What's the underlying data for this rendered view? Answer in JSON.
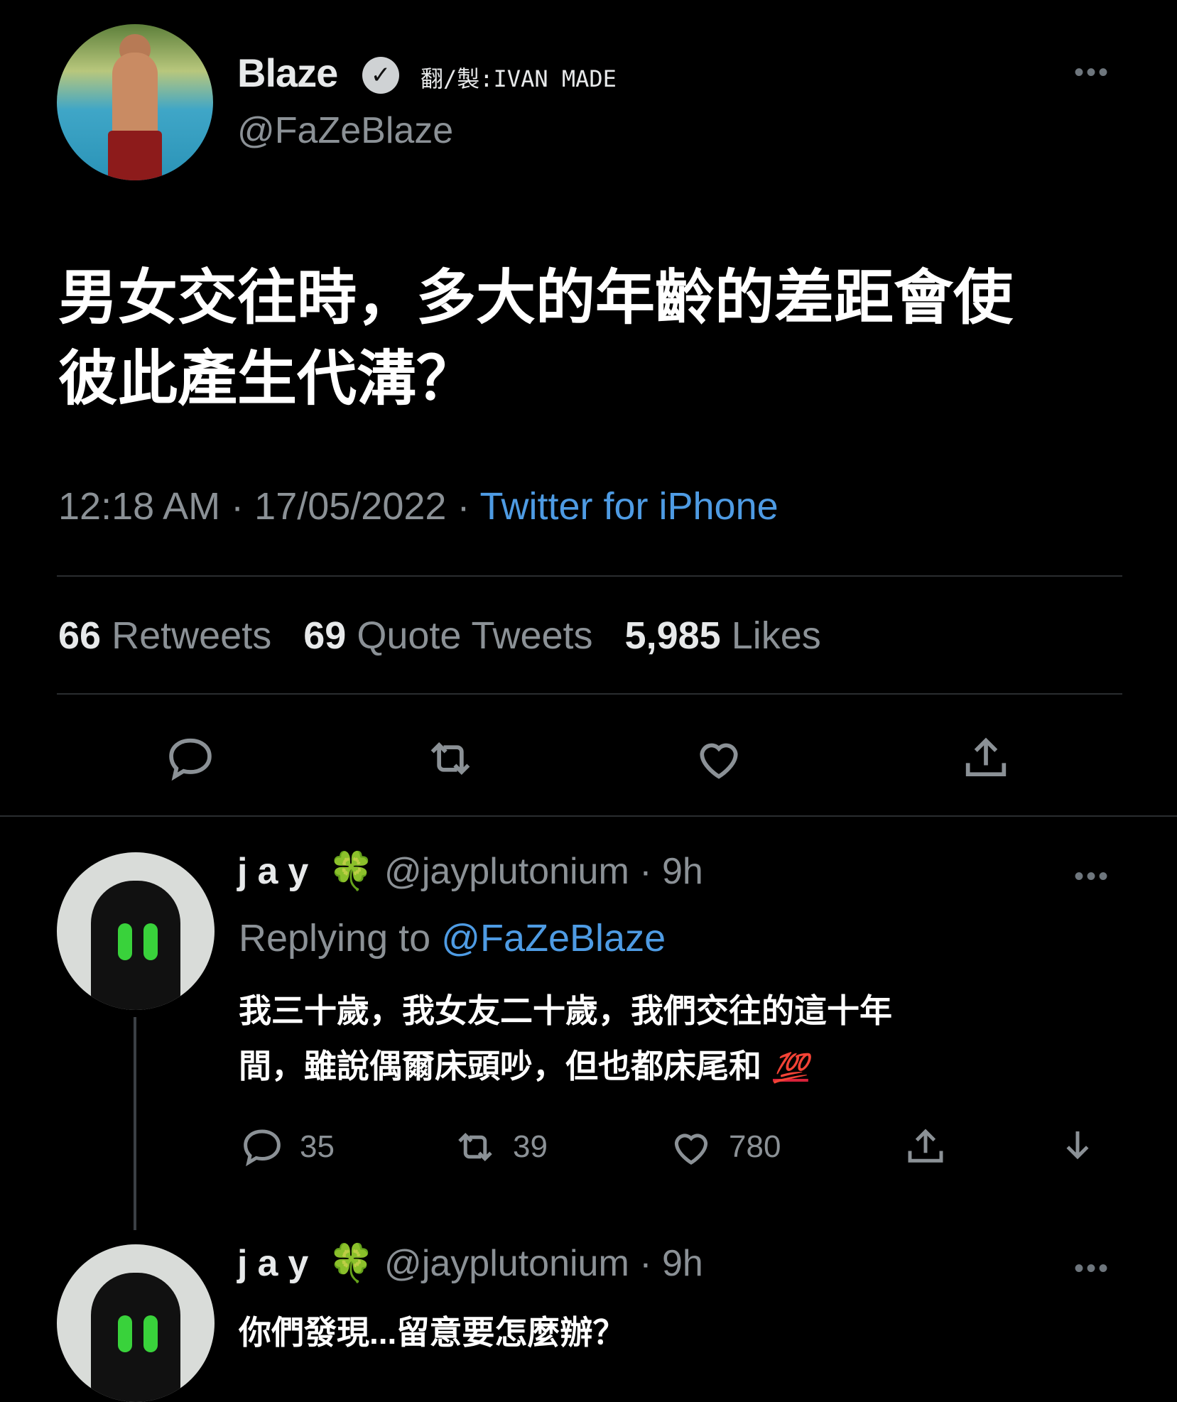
{
  "tweet": {
    "name": "Blaze",
    "verified_icon": "check-badge-icon",
    "credit": "翻/製:IVAN MADE",
    "handle": "@FaZeBlaze",
    "more": "•••",
    "text_line1": "男女交往時，多大的年齡的差距會使",
    "text_line2": "彼此產生代溝？",
    "time": "12:18 AM",
    "date": "17/05/2022",
    "dot1": "·",
    "dot2": "·",
    "source": "Twitter for iPhone",
    "retweets_count": "66",
    "retweets_label": "Retweets",
    "quotes_count": "69",
    "quotes_label": "Quote Tweets",
    "likes_count": "5,985",
    "likes_label": "Likes"
  },
  "reply1": {
    "name": "jay",
    "clover": "🍀",
    "handle_time": "@jayplutonium · 9h",
    "more": "•••",
    "replying_prefix": "Replying to",
    "replying_to": "@FaZeBlaze",
    "text_line1": "我三十歲，我女友二十歲，我們交往的這十年",
    "text_line2": "間，雖說偶爾床頭吵，但也都床尾和",
    "emoji": "💯",
    "replies": "35",
    "retweets": "39",
    "likes": "780"
  },
  "reply2": {
    "name": "jay",
    "clover": "🍀",
    "handle_time": "@jayplutonium · 9h",
    "more": "•••",
    "text_partial": "你們發現...留意要怎麼辦？"
  },
  "colors": {
    "background": "#000000",
    "link": "#4e9be3",
    "muted": "#8b9196",
    "text": "#e7e9ea"
  }
}
